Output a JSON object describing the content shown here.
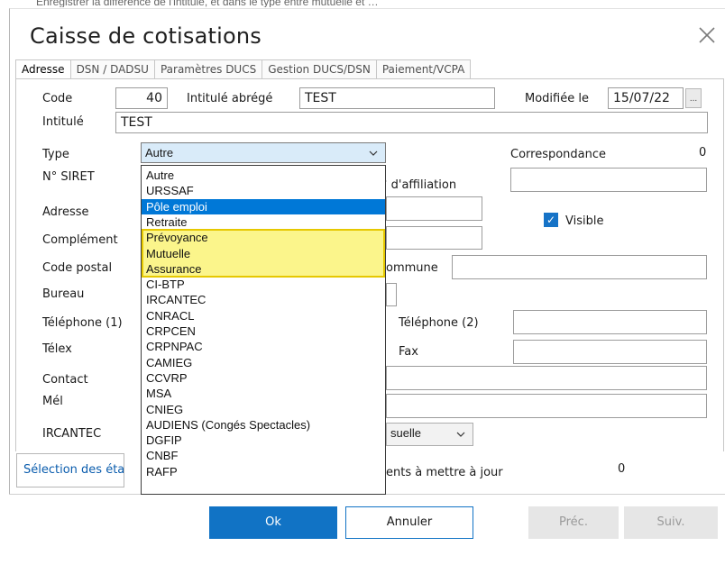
{
  "header_clip": "Enregistrer la différence de l'intitulé, et dans le type entre mutuelle et …",
  "dialog": {
    "title": "Caisse de cotisations"
  },
  "tabs": [
    {
      "label": "Adresse",
      "active": true
    },
    {
      "label": "DSN / DADSU",
      "active": false
    },
    {
      "label": "Paramètres DUCS",
      "active": false
    },
    {
      "label": "Gestion DUCS/DSN",
      "active": false
    },
    {
      "label": "Paiement/VCPA",
      "active": false
    }
  ],
  "form": {
    "code_label": "Code",
    "code_value": "40",
    "short_label": "Intitulé abrégé",
    "short_value": "TEST",
    "modified_label": "Modifiée le",
    "modified_value": "15/07/22",
    "dots": "...",
    "intitule_label": "Intitulé",
    "intitule_value": "TEST",
    "type_label": "Type",
    "type_value": "Autre",
    "corresp_label": "Correspondance",
    "corresp_value": "0",
    "siret_label": "N° SIRET",
    "affiliation_label": "° d'affiliation",
    "adresse_label": "Adresse",
    "complement_label": "Complément",
    "visible_label": "Visible",
    "visible_checked": true,
    "cp_label": "Code postal",
    "commune_label": "ommune",
    "bureau_label": "Bureau",
    "tel1_label": "Téléphone (1)",
    "tel2_label": "Téléphone (2)",
    "telex_label": "Télex",
    "fax_label": "Fax",
    "contact_label": "Contact",
    "mel_label": "Mél",
    "ircantec_label": "IRCANTEC",
    "freq_value": "suelle",
    "selection_label": "Sélection des établissements",
    "update_label": "ents à mettre à jour",
    "update_value": "0"
  },
  "type_options": [
    "Autre",
    "URSSAF",
    "Pôle emploi",
    "Retraite",
    "Prévoyance",
    "Mutuelle",
    "Assurance",
    "CI-BTP",
    "IRCANTEC",
    "CNRACL",
    "CRPCEN",
    "CRPNPAC",
    "CAMIEG",
    "CCVRP",
    "MSA",
    "CNIEG",
    "AUDIENS (Congés Spectacles)",
    "DGFIP",
    "CNBF",
    "RAFP"
  ],
  "type_selected_index": 2,
  "type_highlight_range": [
    4,
    6
  ],
  "buttons": {
    "ok": "Ok",
    "cancel": "Annuler",
    "prev": "Préc.",
    "next": "Suiv."
  },
  "colors": {
    "accent": "#1173c5",
    "selection": "#0078d7",
    "highlight": "#fbf58b",
    "highlight_border": "#e6c800"
  }
}
